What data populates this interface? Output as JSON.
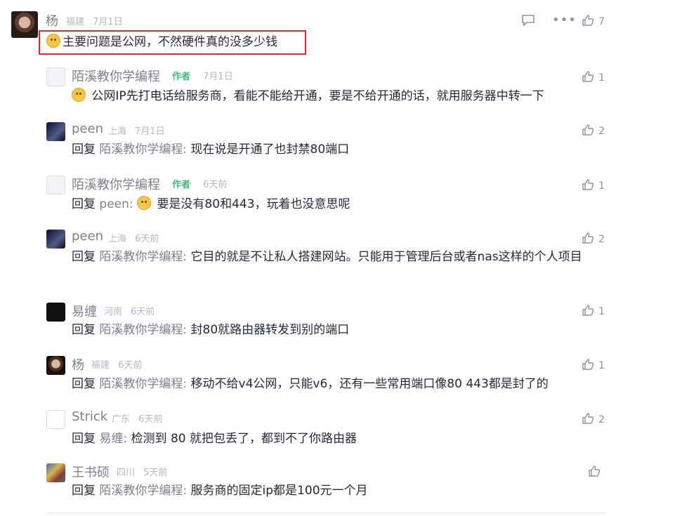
{
  "root": {
    "name": "杨",
    "location": "福建",
    "date": "7月1日",
    "content": "主要问题是公网，不然硬件真的没多少钱",
    "likes": "7"
  },
  "replies": [
    {
      "name": "陌溪教你学编程",
      "author_tag": "作者",
      "location": "",
      "date": "7月1日",
      "prefix": "",
      "target": "",
      "content": "公网IP先打电话给服务商，看能不能给开通，要是不给开通的话，就用服务器中转一下",
      "likes": "1"
    },
    {
      "name": "peen",
      "author_tag": "",
      "location": "上海",
      "date": "7月1日",
      "prefix": "回复",
      "target": "陌溪教你学编程:",
      "content": "现在说是开通了也封禁80端口",
      "likes": "2"
    },
    {
      "name": "陌溪教你学编程",
      "author_tag": "作者",
      "location": "",
      "date": "6天前",
      "prefix": "回复",
      "target": "peen:",
      "content": "要是没有80和443，玩着也没意思呢",
      "likes": "1"
    },
    {
      "name": "peen",
      "author_tag": "",
      "location": "上海",
      "date": "6天前",
      "prefix": "回复",
      "target": "陌溪教你学编程:",
      "content": "它目的就是不让私人搭建网站。只能用于管理后台或者nas这样的个人项目",
      "likes": "2"
    },
    {
      "name": "易缠",
      "author_tag": "",
      "location": "河南",
      "date": "6天前",
      "prefix": "回复",
      "target": "陌溪教你学编程:",
      "content": "封80就路由器转发到别的端口",
      "likes": "1"
    },
    {
      "name": "杨",
      "author_tag": "",
      "location": "福建",
      "date": "6天前",
      "prefix": "回复",
      "target": "陌溪教你学编程:",
      "content": "移动不给v4公网，只能v6，还有一些常用端口像80 443都是封了的",
      "likes": "1"
    },
    {
      "name": "Strick",
      "author_tag": "",
      "location": "广东",
      "date": "6天前",
      "prefix": "回复",
      "target": "易缠:",
      "content": "检测到 80 就把包丢了，都到不了你路由器",
      "likes": "2"
    },
    {
      "name": "王书硕",
      "author_tag": "",
      "location": "四川",
      "date": "5天前",
      "prefix": "回复",
      "target": "陌溪教你学编程:",
      "content": "服务商的固定ip都是100元一个月",
      "likes": ""
    }
  ]
}
